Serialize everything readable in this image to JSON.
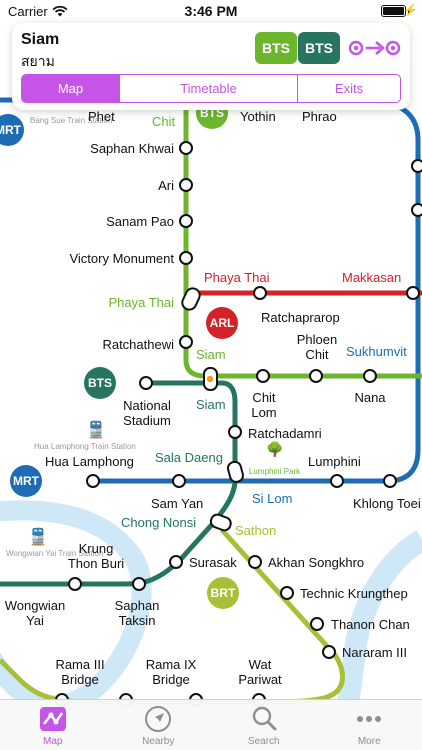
{
  "status_bar": {
    "carrier": "Carrier",
    "time": "3:46 PM"
  },
  "station_card": {
    "name": "Siam",
    "name_thai": "สยาม",
    "line_badges": [
      "BTS",
      "BTS"
    ],
    "tabs": [
      {
        "label": "Map",
        "active": true
      },
      {
        "label": "Timetable",
        "active": false
      },
      {
        "label": "Exits",
        "active": false
      }
    ]
  },
  "map": {
    "badges": {
      "mrt_top": "MRT",
      "bts_top": "BTS",
      "arl": "ARL",
      "bts_mid": "BTS",
      "mrt_mid": "MRT",
      "brt": "BRT"
    },
    "landmarks": {
      "bang_sue": "Bang Sue Train Station",
      "hua_lamphong_train": "Hua Lamphong Train Station",
      "wongwian_yai_train": "Wongwian Yai Train Station",
      "lumphini_park": "Lumphini Park"
    },
    "line_labels": {
      "phaya_thai_arl": "Phaya Thai",
      "makkasan": "Makkasan",
      "phaya_thai_bts": "Phaya Thai",
      "siam_sukhumvit": "Siam",
      "siam_silom": "Siam",
      "sukhumvit": "Sukhumvit",
      "sala_daeng": "Sala Daeng",
      "si_lom": "Si Lom",
      "chong_nonsi": "Chong Nonsi",
      "sathon": "Sathon",
      "chit": "Chit"
    },
    "stations": {
      "phet": "Phet",
      "yothin": "Yothin",
      "phrao": "Phrao",
      "saphan_khwai": "Saphan Khwai",
      "ari": "Ari",
      "sanam_pao": "Sanam Pao",
      "victory_monument": "Victory Monument",
      "ratchaprarop": "Ratchaprarop",
      "ratchathewi": "Ratchathewi",
      "phloen_chit": "Phloen\nChit",
      "national_stadium": "National\nStadium",
      "chit_lom": "Chit\nLom",
      "nana": "Nana",
      "ratchadamri": "Ratchadamri",
      "hua_lamphong": "Hua Lamphong",
      "lumphini": "Lumphini",
      "sam_yan": "Sam Yan",
      "khlong_toei": "Khlong Toei",
      "akhan_songkhro": "Akhan Songkhro",
      "krung_thon_buri": "Krung\nThon Buri",
      "surasak": "Surasak",
      "technic_krungthep": "Technic Krungthep",
      "wongwian_yai": "Wongwian\nYai",
      "saphan_taksin": "Saphan\nTaksin",
      "thanon_chan": "Thanon Chan",
      "nararam_iii": "Nararam III",
      "rama_iii_bridge": "Rama III\nBridge",
      "rama_ix_bridge": "Rama IX\nBridge",
      "wat_pariwat": "Wat\nPariwat"
    }
  },
  "colors": {
    "accent": "#c455e8",
    "bts_sukhumvit": "#6cb52d",
    "bts_silom": "#257560",
    "arl": "#d52128",
    "mrt": "#1d6cb4",
    "brt": "#a7c038",
    "river": "#c9e6f7"
  },
  "tab_bar": [
    {
      "label": "Map",
      "icon": "map-icon",
      "active": true
    },
    {
      "label": "Nearby",
      "icon": "location-arrow-icon",
      "active": false
    },
    {
      "label": "Search",
      "icon": "search-icon",
      "active": false
    },
    {
      "label": "More",
      "icon": "more-dots-icon",
      "active": false
    }
  ]
}
